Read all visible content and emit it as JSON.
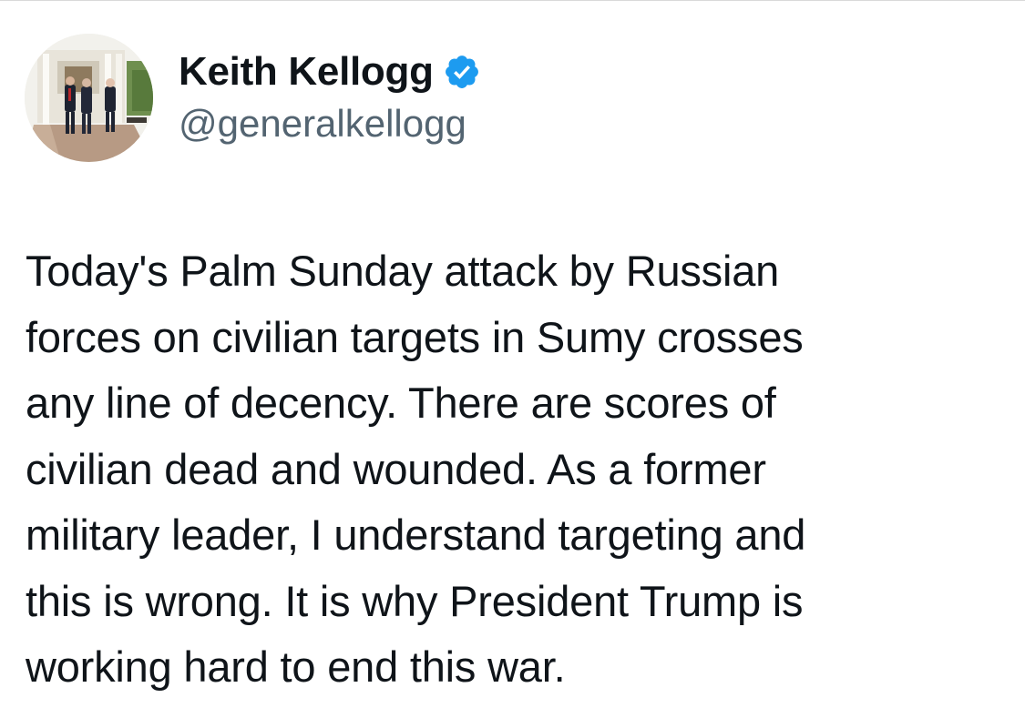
{
  "author": {
    "display_name": "Keith Kellogg",
    "handle": "@generalkellogg",
    "verified_icon": "verified-badge-icon",
    "avatar_icon": "profile-photo"
  },
  "tweet": {
    "text": "Today's Palm Sunday attack by Russian\nforces on civilian targets in Sumy crosses\nany line of decency.  There are scores of\ncivilian dead and wounded. As a former\nmilitary leader, I understand targeting and\nthis is wrong. It is why President Trump is\nworking hard to end this war."
  },
  "colors": {
    "text": "#0f1419",
    "secondary_text": "#536471",
    "verified_blue": "#1d9bf0",
    "background": "#ffffff"
  }
}
